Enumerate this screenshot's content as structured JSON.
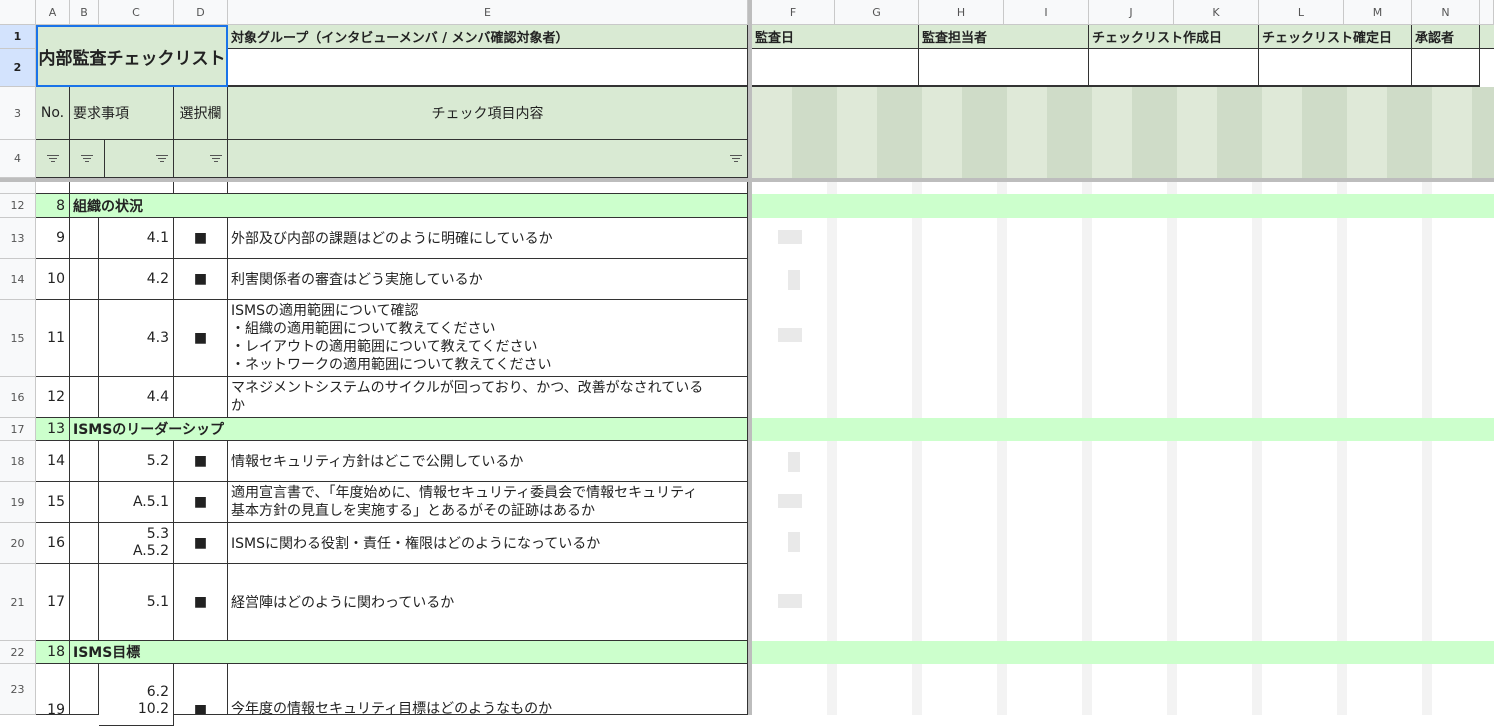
{
  "columns": [
    "A",
    "B",
    "C",
    "D",
    "E",
    "F",
    "G",
    "H",
    "I",
    "J",
    "K",
    "L",
    "M",
    "N"
  ],
  "row_numbers": [
    "1",
    "2",
    "3",
    "4",
    "12",
    "13",
    "14",
    "15",
    "16",
    "17",
    "18",
    "19",
    "20",
    "21",
    "22",
    "23"
  ],
  "header": {
    "title": "内部監査チェックリスト",
    "target_group_label": "対象グループ（インタビューメンバ / メンバ確認対象者）",
    "audit_date_label": "監査日",
    "auditor_label": "監査担当者",
    "created_date_label": "チェックリスト作成日",
    "confirmed_date_label": "チェックリスト確定日",
    "approver_label": "承認者",
    "col_no": "No.",
    "col_requirement": "要求事項",
    "col_selection": "選択欄",
    "col_check_item": "チェック項目内容"
  },
  "rows": [
    {
      "row": "12",
      "no": "8",
      "section": "組織の状況"
    },
    {
      "row": "13",
      "no": "9",
      "req": "4.1",
      "sel": "■",
      "text": "外部及び内部の課題はどのように明確にしているか"
    },
    {
      "row": "14",
      "no": "10",
      "req": "4.2",
      "sel": "■",
      "text": "利害関係者の審査はどう実施しているか"
    },
    {
      "row": "15",
      "no": "11",
      "req": "4.3",
      "sel": "■",
      "text": "ISMSの適用範囲について確認\n・組織の適用範囲について教えてください\n・レイアウトの適用範囲について教えてください\n・ネットワークの適用範囲について教えてください"
    },
    {
      "row": "16",
      "no": "12",
      "req": "4.4",
      "sel": "",
      "text": "マネジメントシステムのサイクルが回っており、かつ、改善がなされている\nか"
    },
    {
      "row": "17",
      "no": "13",
      "section": "ISMSのリーダーシップ"
    },
    {
      "row": "18",
      "no": "14",
      "req": "5.2",
      "sel": "■",
      "text": "情報セキュリティ方針はどこで公開しているか"
    },
    {
      "row": "19",
      "no": "15",
      "req": "A.5.1",
      "sel": "■",
      "text": "適用宣言書で、「年度始めに、情報セキュリティ委員会で情報セキュリティ\n基本方針の見直しを実施する」とあるがその証跡はあるか"
    },
    {
      "row": "20",
      "no": "16",
      "req": "5.3\nA.5.2",
      "sel": "■",
      "text": "ISMSに関わる役割・責任・権限はどのようになっているか"
    },
    {
      "row": "21",
      "no": "17",
      "req": "5.1",
      "sel": "■",
      "text": "経営陣はどのように関わっているか"
    },
    {
      "row": "22",
      "no": "18",
      "section": "ISMS目標"
    },
    {
      "row": "23",
      "no": "19",
      "req": "6.2\n10.2",
      "sel": "■",
      "text": "今年度の情報セキュリティ目標はどのようなものか"
    }
  ]
}
